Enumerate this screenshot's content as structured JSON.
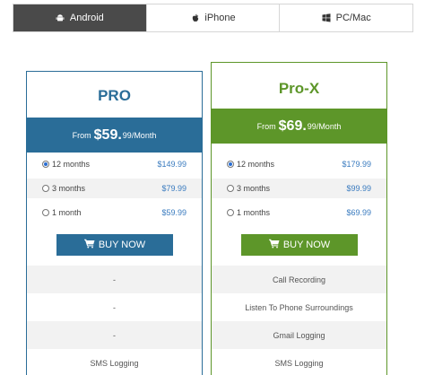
{
  "tabs": [
    {
      "label": "Android",
      "icon": "android-icon",
      "active": true
    },
    {
      "label": "iPhone",
      "icon": "apple-icon",
      "active": false
    },
    {
      "label": "PC/Mac",
      "icon": "windows-icon",
      "active": false
    }
  ],
  "plans": [
    {
      "name": "PRO",
      "color": "#2a6d98",
      "price_from": "From",
      "price_main": "$59.",
      "price_cents": "99",
      "price_period": "/Month",
      "options": [
        {
          "term": "12 months",
          "price": "$149.99",
          "selected": true
        },
        {
          "term": "3 months",
          "price": "$79.99",
          "selected": false
        },
        {
          "term": "1 month",
          "price": "$59.99",
          "selected": false
        }
      ],
      "buy_label": "BUY NOW",
      "features": [
        "-",
        "-",
        "-",
        "SMS Logging"
      ]
    },
    {
      "name": "Pro-X",
      "color": "#5d9629",
      "price_from": "From",
      "price_main": "$69.",
      "price_cents": "99",
      "price_period": "/Month",
      "options": [
        {
          "term": "12 months",
          "price": "$179.99",
          "selected": true
        },
        {
          "term": "3 months",
          "price": "$99.99",
          "selected": false
        },
        {
          "term": "1 months",
          "price": "$69.99",
          "selected": false
        }
      ],
      "buy_label": "BUY NOW",
      "features": [
        "Call Recording",
        "Listen To Phone Surroundings",
        "Gmail Logging",
        "SMS Logging"
      ]
    }
  ]
}
